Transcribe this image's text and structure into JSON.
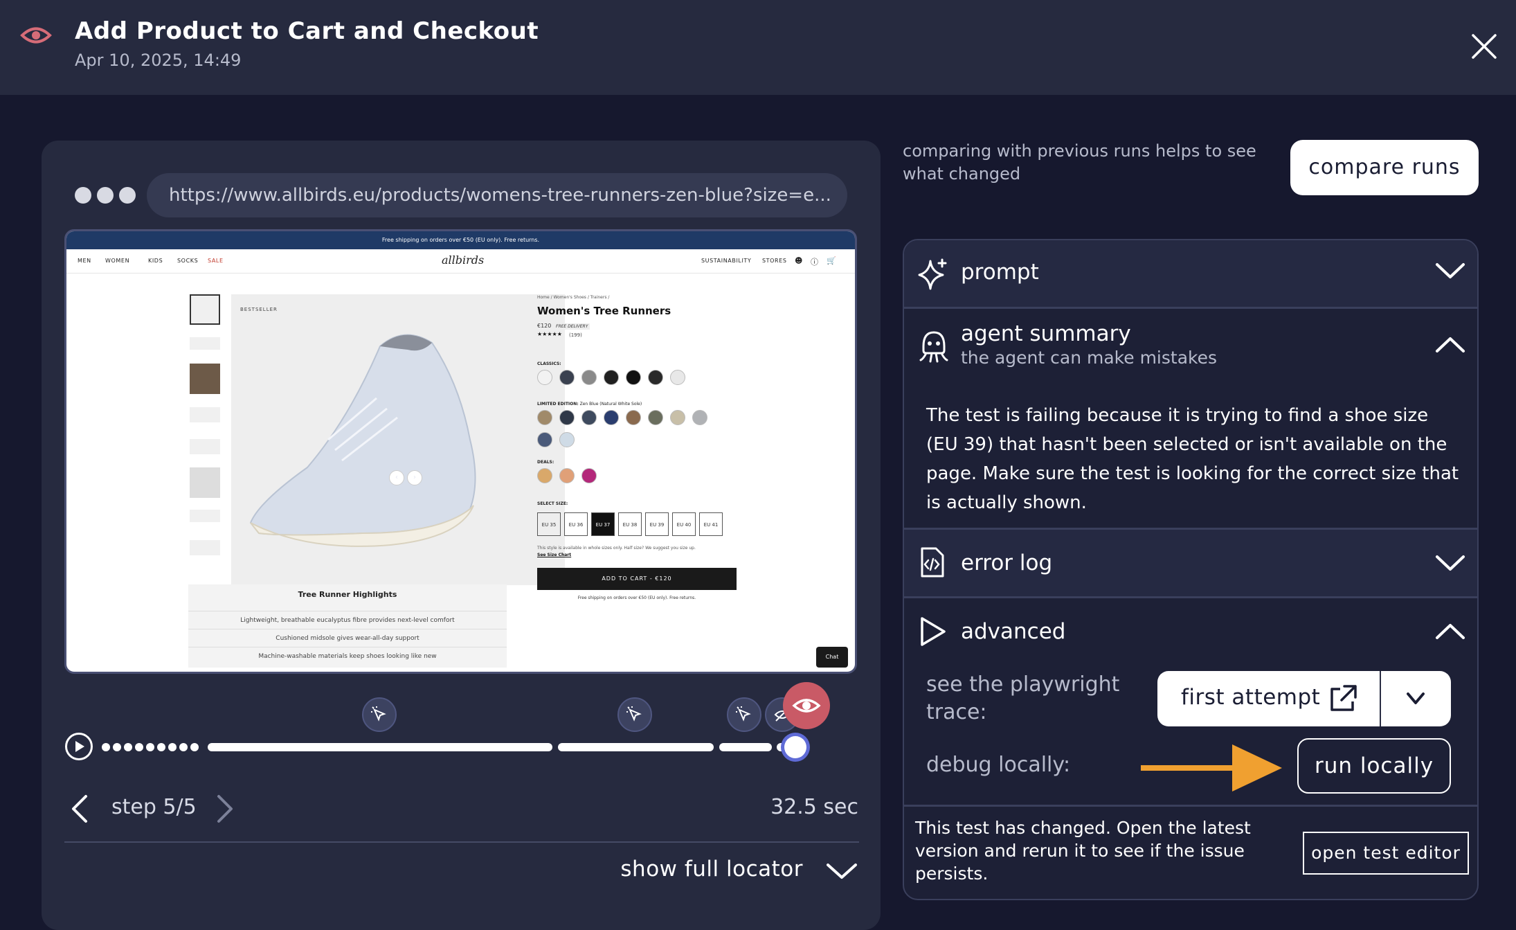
{
  "header": {
    "title": "Add Product to Cart and Checkout",
    "date": "Apr 10, 2025, 14:49",
    "eye_icon": "eye-icon",
    "close_icon": "close-icon"
  },
  "browser": {
    "url": "https://www.allbirds.eu/products/womens-tree-runners-zen-blue?size=e..."
  },
  "site": {
    "announcement": "Free shipping on orders over €50 (EU only). Free returns.",
    "nav_left": [
      "MEN",
      "WOMEN",
      "KIDS",
      "SOCKS",
      "SALE"
    ],
    "logo": "allbirds",
    "nav_right": [
      "SUSTAINABILITY",
      "STORES"
    ],
    "badge": "BESTSELLER",
    "breadcrumb": "Home / Women's Shoes / Trainers /",
    "product_name": "Women's Tree Runners",
    "price": "€120",
    "delivery": "FREE DELIVERY",
    "rating_count": "(199)",
    "classics_label": "CLASSICS:",
    "limited_label": "LIMITED EDITION:",
    "limited_value": "Zen Blue (Natural White Sole)",
    "deals_label": "DEALS:",
    "size_label": "SELECT SIZE:",
    "sizes": [
      "EU 35",
      "EU 36",
      "EU 37",
      "EU 38",
      "EU 39",
      "EU 40",
      "EU 41"
    ],
    "selected_size_index": 2,
    "size_note": "This style is available in whole sizes only. Half size? We suggest you size up.",
    "size_chart": "See Size Chart",
    "add_to_cart": "ADD TO CART - €120",
    "shipping_note": "Free shipping on orders over €50 (EU only). Free returns.",
    "highlights_title": "Tree Runner Highlights",
    "highlights": [
      "Lightweight, breathable eucalyptus fibre provides next-level comfort",
      "Cushioned midsole gives wear-all-day support",
      "Machine-washable materials keep shoes looking like new"
    ],
    "chat": "Chat",
    "classic_colors": [
      "#f2f2f2",
      "#3a4150",
      "#8a8a8a",
      "#202020",
      "#111111",
      "#2a2a2a",
      "#e8e8e8"
    ],
    "limited_colors": [
      "#a08a6a",
      "#2f3848",
      "#3e4a5e",
      "#2a3d6e",
      "#8a6a4e",
      "#6a6e5e",
      "#c8bfa8",
      "#b0b2b5",
      "#4a5a7a",
      "#cfdbe6"
    ],
    "deal_colors": [
      "#d9a86a",
      "#e0a078",
      "#b3287a"
    ]
  },
  "player": {
    "step_label": "step 5/5",
    "duration": "32.5 sec",
    "locator_label": "show full locator"
  },
  "right": {
    "hint": "comparing with previous runs helps to see what changed",
    "compare_button": "compare runs",
    "prompt_label": "prompt",
    "summary_label": "agent summary",
    "summary_sub": "the agent can make mistakes",
    "summary_text": "The test is failing because it is trying to find a shoe size (EU 39) that hasn't been selected or isn't available on the page. Make sure the test is looking for the correct size that is actually shown.",
    "error_log_label": "error log",
    "advanced_label": "advanced",
    "trace_label": "see the playwright trace:",
    "trace_button": "first attempt",
    "debug_label": "debug locally:",
    "run_button": "run locally",
    "changed_text": "This test has changed. Open the latest version and rerun it to see if the issue persists.",
    "editor_button": "open test editor",
    "arrow_color": "#f0a030"
  }
}
